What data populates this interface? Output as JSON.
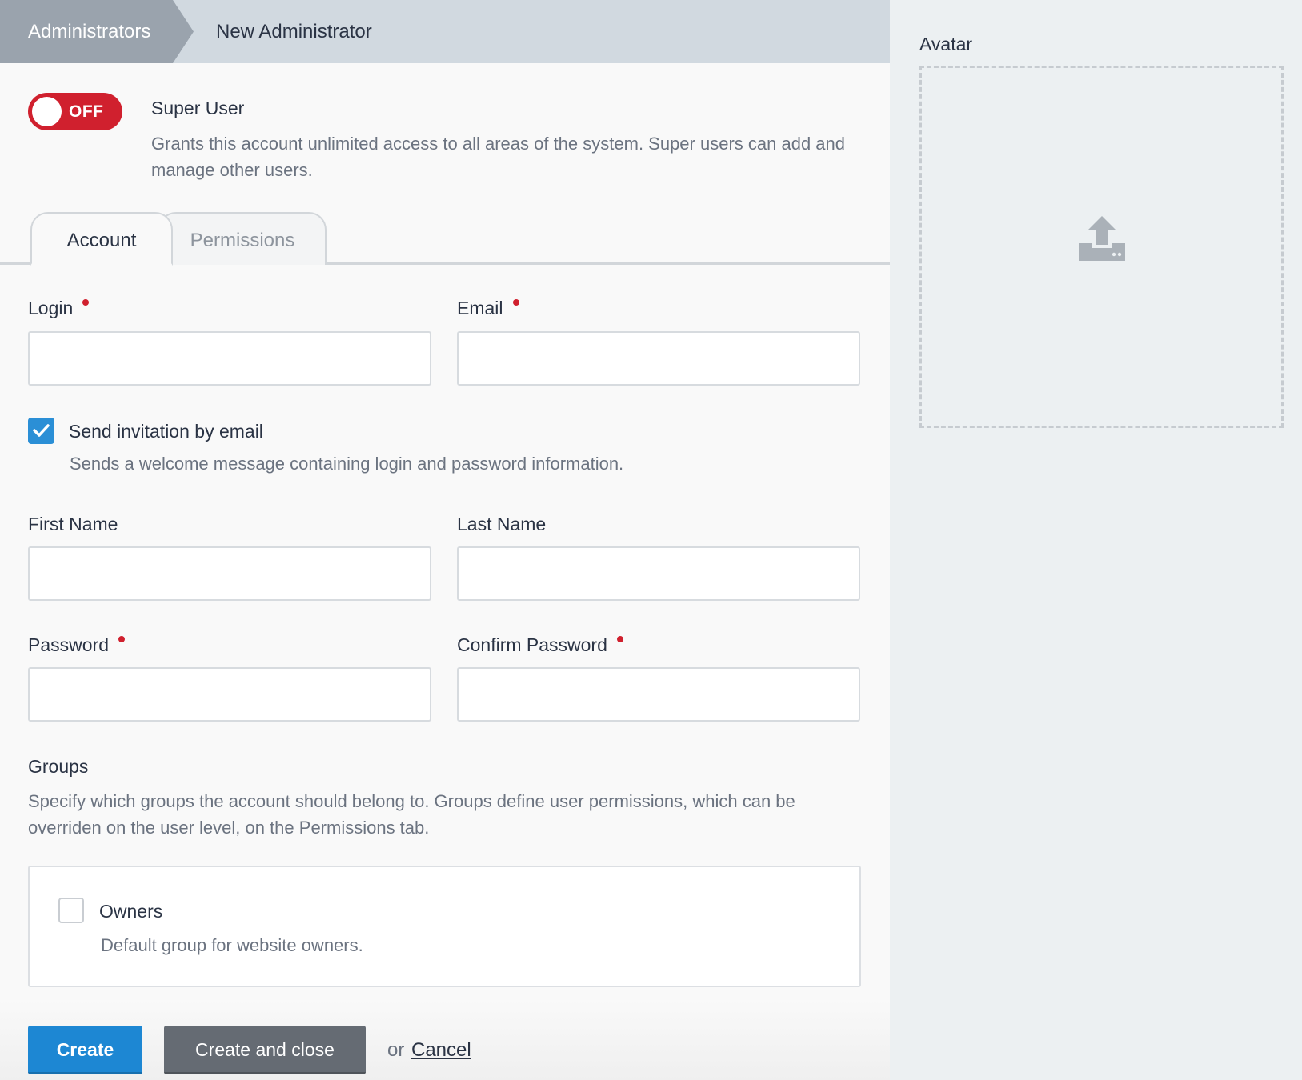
{
  "breadcrumb": {
    "parent": "Administrators",
    "current": "New Administrator"
  },
  "super_user": {
    "toggle_text": "OFF",
    "title": "Super User",
    "description": "Grants this account unlimited access to all areas of the system. Super users can add and manage other users."
  },
  "tabs": [
    {
      "label": "Account",
      "active": true
    },
    {
      "label": "Permissions",
      "active": false
    }
  ],
  "fields": {
    "login": {
      "label": "Login",
      "value": ""
    },
    "email": {
      "label": "Email",
      "value": ""
    },
    "first_name": {
      "label": "First Name",
      "value": ""
    },
    "last_name": {
      "label": "Last Name",
      "value": ""
    },
    "password": {
      "label": "Password",
      "value": ""
    },
    "confirm_password": {
      "label": "Confirm Password",
      "value": ""
    }
  },
  "invitation": {
    "label": "Send invitation by email",
    "description": "Sends a welcome message containing login and password information.",
    "checked": true
  },
  "groups": {
    "title": "Groups",
    "description": "Specify which groups the account should belong to. Groups define user permissions, which can be overriden on the user level, on the Permissions tab.",
    "items": [
      {
        "label": "Owners",
        "description": "Default group for website owners.",
        "checked": false
      }
    ]
  },
  "footer": {
    "create_label": "Create",
    "create_close_label": "Create and close",
    "or_text": "or",
    "cancel_label": "Cancel"
  },
  "sidebar": {
    "avatar_label": "Avatar",
    "upload_icon": "upload-icon"
  },
  "colors": {
    "accent": "#1d87d3",
    "danger": "#d0202e",
    "checkbox": "#2b8fd6"
  }
}
